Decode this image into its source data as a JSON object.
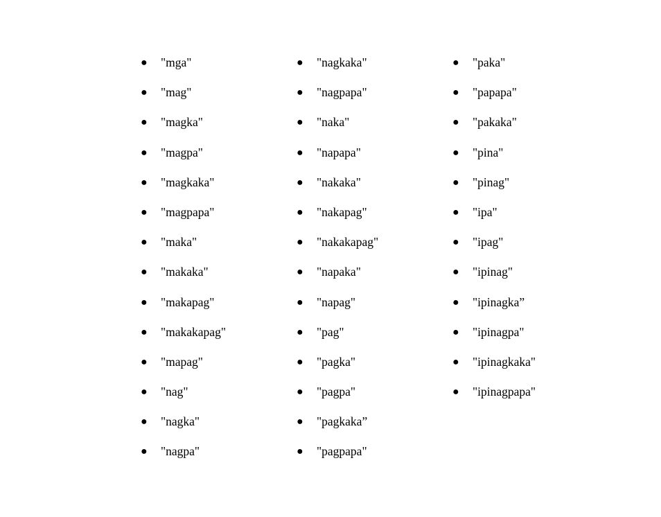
{
  "bullet_glyph": "●",
  "columns": [
    {
      "items": [
        "\"mga\"",
        "\"mag\"",
        "\"magka\"",
        "\"magpa\"",
        "\"magkaka\"",
        "\"magpapa\"",
        "\"maka\"",
        "\"makaka\"",
        "\"makapag\"",
        "\"makakapag\"",
        "\"mapag\"",
        "\"nag\"",
        "\"nagka\"",
        "\"nagpa\""
      ]
    },
    {
      "items": [
        "\"nagkaka\"",
        "\"nagpapa\"",
        "\"naka\"",
        "\"napapa\"",
        "\"nakaka\"",
        "\"nakapag\"",
        "\"nakakapag\"",
        "\"napaka\"",
        "\"napag\"",
        "\"pag\"",
        "\"pagka\"",
        "\"pagpa\"",
        "\"pagkaka”",
        "\"pagpapa\""
      ]
    },
    {
      "items": [
        "\"paka\"",
        "\"papapa\"",
        "\"pakaka\"",
        "\"pina\"",
        "\"pinag\"",
        "\"ipa\"",
        "\"ipag\"",
        "\"ipinag\"",
        "\"ipinagka”",
        "\"ipinagpa\"",
        "\"ipinagkaka\"",
        "\"ipinagpapa\""
      ]
    }
  ]
}
